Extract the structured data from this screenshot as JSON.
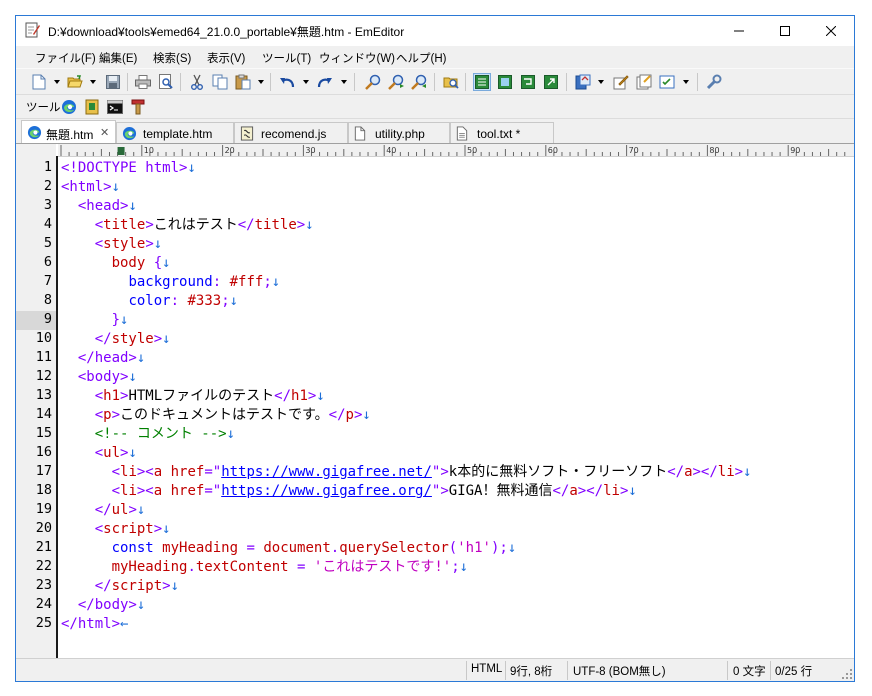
{
  "window": {
    "title": "D:¥download¥tools¥emed64_21.0.0_portable¥無題.htm - EmEditor",
    "minimize_glyph": "—",
    "maximize_glyph": "☐",
    "close_glyph": "✕"
  },
  "menu": {
    "items": [
      {
        "label": "ファイル(F)"
      },
      {
        "label": "編集(E)"
      },
      {
        "label": "検索(S)"
      },
      {
        "label": "表示(V)"
      },
      {
        "label": "ツール(T)"
      },
      {
        "label": "ウィンドウ(W)"
      },
      {
        "label": "ヘルプ(H)"
      }
    ]
  },
  "toolbar2": {
    "label": "ツール"
  },
  "tabs": [
    {
      "label": "無題.htm",
      "icon": "edge-icon",
      "active": true,
      "close": "✕"
    },
    {
      "label": "template.htm",
      "icon": "edge-icon",
      "active": false
    },
    {
      "label": "recomend.js",
      "icon": "script-icon",
      "active": false
    },
    {
      "label": "utility.php",
      "icon": "file-icon",
      "active": false
    },
    {
      "label": "tool.txt *",
      "icon": "text-file-icon",
      "active": false
    }
  ],
  "ruler": {
    "labels": [
      "10",
      "20",
      "30",
      "40",
      "50",
      "60",
      "70",
      "80",
      "90"
    ]
  },
  "editor": {
    "current_line": 9,
    "lines": [
      {
        "n": "1"
      },
      {
        "n": "2"
      },
      {
        "n": "3"
      },
      {
        "n": "4"
      },
      {
        "n": "5"
      },
      {
        "n": "6"
      },
      {
        "n": "7"
      },
      {
        "n": "8"
      },
      {
        "n": "9"
      },
      {
        "n": "10"
      },
      {
        "n": "11"
      },
      {
        "n": "12"
      },
      {
        "n": "13"
      },
      {
        "n": "14"
      },
      {
        "n": "15"
      },
      {
        "n": "16"
      },
      {
        "n": "17"
      },
      {
        "n": "18"
      },
      {
        "n": "19"
      },
      {
        "n": "20"
      },
      {
        "n": "21"
      },
      {
        "n": "22"
      },
      {
        "n": "23"
      },
      {
        "n": "24"
      },
      {
        "n": "25"
      }
    ],
    "code": [
      [
        [
          "c-tag",
          "<!DOCTYPE html>"
        ],
        [
          "c-mark",
          "↓"
        ]
      ],
      [
        [
          "c-tag",
          "<html>"
        ],
        [
          "c-mark",
          "↓"
        ]
      ],
      [
        [
          "c-text",
          "  "
        ],
        [
          "c-tag",
          "<head>"
        ],
        [
          "c-mark",
          "↓"
        ]
      ],
      [
        [
          "c-text",
          "    "
        ],
        [
          "c-tag",
          "<"
        ],
        [
          "c-elem",
          "title"
        ],
        [
          "c-tag",
          ">"
        ],
        [
          "c-text",
          "これはテスト"
        ],
        [
          "c-tag",
          "</"
        ],
        [
          "c-elem",
          "title"
        ],
        [
          "c-tag",
          ">"
        ],
        [
          "c-mark",
          "↓"
        ]
      ],
      [
        [
          "c-text",
          "    "
        ],
        [
          "c-tag",
          "<"
        ],
        [
          "c-elem",
          "style"
        ],
        [
          "c-tag",
          ">"
        ],
        [
          "c-mark",
          "↓"
        ]
      ],
      [
        [
          "c-text",
          "      "
        ],
        [
          "c-js",
          "body"
        ],
        [
          "c-text",
          " "
        ],
        [
          "c-tag",
          "{"
        ],
        [
          "c-mark",
          "↓"
        ]
      ],
      [
        [
          "c-text",
          "        "
        ],
        [
          "c-kw",
          "background"
        ],
        [
          "c-tag",
          ":"
        ],
        [
          "c-text",
          " "
        ],
        [
          "c-js",
          "#fff"
        ],
        [
          "c-tag",
          ";"
        ],
        [
          "c-mark",
          "↓"
        ]
      ],
      [
        [
          "c-text",
          "        "
        ],
        [
          "c-kw",
          "color"
        ],
        [
          "c-tag",
          ":"
        ],
        [
          "c-text",
          " "
        ],
        [
          "c-js",
          "#333"
        ],
        [
          "c-tag",
          ";"
        ],
        [
          "c-mark",
          "↓"
        ]
      ],
      [
        [
          "c-text",
          "      "
        ],
        [
          "c-tag",
          "}"
        ],
        [
          "c-mark",
          "↓"
        ]
      ],
      [
        [
          "c-text",
          "    "
        ],
        [
          "c-tag",
          "</"
        ],
        [
          "c-elem",
          "style"
        ],
        [
          "c-tag",
          ">"
        ],
        [
          "c-mark",
          "↓"
        ]
      ],
      [
        [
          "c-text",
          "  "
        ],
        [
          "c-tag",
          "</head>"
        ],
        [
          "c-mark",
          "↓"
        ]
      ],
      [
        [
          "c-text",
          "  "
        ],
        [
          "c-tag",
          "<body>"
        ],
        [
          "c-mark",
          "↓"
        ]
      ],
      [
        [
          "c-text",
          "    "
        ],
        [
          "c-tag",
          "<"
        ],
        [
          "c-elem",
          "h1"
        ],
        [
          "c-tag",
          ">"
        ],
        [
          "c-text",
          "HTMLファイルのテスト"
        ],
        [
          "c-tag",
          "</"
        ],
        [
          "c-elem",
          "h1"
        ],
        [
          "c-tag",
          ">"
        ],
        [
          "c-mark",
          "↓"
        ]
      ],
      [
        [
          "c-text",
          "    "
        ],
        [
          "c-tag",
          "<"
        ],
        [
          "c-elem",
          "p"
        ],
        [
          "c-tag",
          ">"
        ],
        [
          "c-text",
          "このドキュメントはテストです。"
        ],
        [
          "c-tag",
          "</"
        ],
        [
          "c-elem",
          "p"
        ],
        [
          "c-tag",
          ">"
        ],
        [
          "c-mark",
          "↓"
        ]
      ],
      [
        [
          "c-text",
          "    "
        ],
        [
          "c-cmt",
          "<!-- コメント -->"
        ],
        [
          "c-mark",
          "↓"
        ]
      ],
      [
        [
          "c-text",
          "    "
        ],
        [
          "c-tag",
          "<"
        ],
        [
          "c-elem",
          "ul"
        ],
        [
          "c-tag",
          ">"
        ],
        [
          "c-mark",
          "↓"
        ]
      ],
      [
        [
          "c-text",
          "      "
        ],
        [
          "c-tag",
          "<"
        ],
        [
          "c-elem",
          "li"
        ],
        [
          "c-tag",
          "><"
        ],
        [
          "c-elem",
          "a"
        ],
        [
          "c-text",
          " "
        ],
        [
          "c-js",
          "href"
        ],
        [
          "c-tag",
          "=\""
        ],
        [
          "c-url",
          "https://www.gigafree.net/"
        ],
        [
          "c-tag",
          "\">"
        ],
        [
          "c-text",
          "k本的に無料ソフト・フリーソフト"
        ],
        [
          "c-tag",
          "</"
        ],
        [
          "c-elem",
          "a"
        ],
        [
          "c-tag",
          "></"
        ],
        [
          "c-elem",
          "li"
        ],
        [
          "c-tag",
          ">"
        ],
        [
          "c-mark",
          "↓"
        ]
      ],
      [
        [
          "c-text",
          "      "
        ],
        [
          "c-tag",
          "<"
        ],
        [
          "c-elem",
          "li"
        ],
        [
          "c-tag",
          "><"
        ],
        [
          "c-elem",
          "a"
        ],
        [
          "c-text",
          " "
        ],
        [
          "c-js",
          "href"
        ],
        [
          "c-tag",
          "=\""
        ],
        [
          "c-url",
          "https://www.gigafree.org/"
        ],
        [
          "c-tag",
          "\">"
        ],
        [
          "c-text",
          "GIGA！無料通信"
        ],
        [
          "c-tag",
          "</"
        ],
        [
          "c-elem",
          "a"
        ],
        [
          "c-tag",
          "></"
        ],
        [
          "c-elem",
          "li"
        ],
        [
          "c-tag",
          ">"
        ],
        [
          "c-mark",
          "↓"
        ]
      ],
      [
        [
          "c-text",
          "    "
        ],
        [
          "c-tag",
          "</"
        ],
        [
          "c-elem",
          "ul"
        ],
        [
          "c-tag",
          ">"
        ],
        [
          "c-mark",
          "↓"
        ]
      ],
      [
        [
          "c-text",
          "    "
        ],
        [
          "c-tag",
          "<"
        ],
        [
          "c-elem",
          "script"
        ],
        [
          "c-tag",
          ">"
        ],
        [
          "c-mark",
          "↓"
        ]
      ],
      [
        [
          "c-text",
          "      "
        ],
        [
          "c-kw",
          "const"
        ],
        [
          "c-text",
          " "
        ],
        [
          "c-js",
          "myHeading"
        ],
        [
          "c-text",
          " "
        ],
        [
          "c-tag",
          "="
        ],
        [
          "c-text",
          " "
        ],
        [
          "c-js",
          "document"
        ],
        [
          "c-tag",
          "."
        ],
        [
          "c-js",
          "querySelector"
        ],
        [
          "c-tag",
          "("
        ],
        [
          "c-str",
          "'h1'"
        ],
        [
          "c-tag",
          ");"
        ],
        [
          "c-mark",
          "↓"
        ]
      ],
      [
        [
          "c-text",
          "      "
        ],
        [
          "c-js",
          "myHeading"
        ],
        [
          "c-tag",
          "."
        ],
        [
          "c-js",
          "textContent"
        ],
        [
          "c-text",
          " "
        ],
        [
          "c-tag",
          "="
        ],
        [
          "c-text",
          " "
        ],
        [
          "c-str",
          "'これはテストです!'"
        ],
        [
          "c-tag",
          ";"
        ],
        [
          "c-mark",
          "↓"
        ]
      ],
      [
        [
          "c-text",
          "    "
        ],
        [
          "c-tag",
          "</"
        ],
        [
          "c-elem",
          "script"
        ],
        [
          "c-tag",
          ">"
        ],
        [
          "c-mark",
          "↓"
        ]
      ],
      [
        [
          "c-text",
          "  "
        ],
        [
          "c-tag",
          "</body>"
        ],
        [
          "c-mark",
          "↓"
        ]
      ],
      [
        [
          "c-tag",
          "</html>"
        ],
        [
          "c-mark",
          "←"
        ]
      ]
    ]
  },
  "status": {
    "mode": "HTML",
    "position": "9行, 8桁",
    "encoding": "UTF-8 (BOM無し)",
    "chars": "0 文字",
    "lines": "0/25 行"
  }
}
